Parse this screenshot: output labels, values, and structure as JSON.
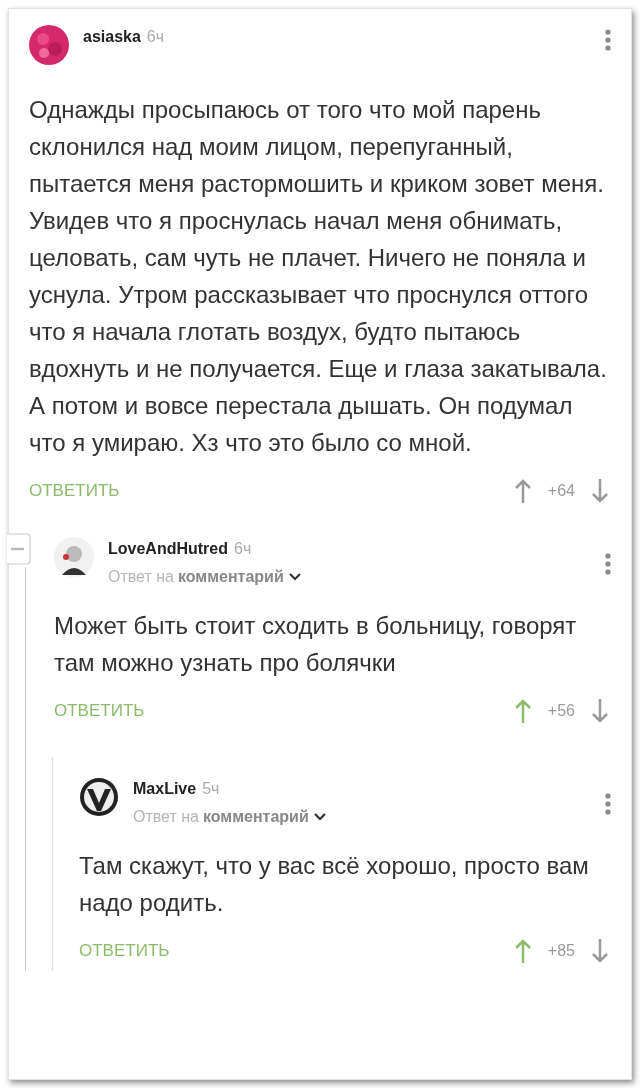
{
  "comments": [
    {
      "author": "asiaska",
      "time": "6ч",
      "text": "Однажды просыпаюсь от того что мой парень склонился над моим лицом, перепуганный, пытается меня растормошить и криком зовет меня. Увидев что я проснулась начал меня обнимать, целовать, сам чуть не плачет. Ничего не поняла и уснула. Утром рассказывает что проснулся оттого что я начала глотать воздух, будто пытаюсь вдохнуть и не получается. Еще и глаза закатывала. А потом и вовсе перестала дышать. Он подумал что я умираю. Хз что это было со мной.",
      "reply_label": "ОТВЕТИТЬ",
      "score": "+64",
      "upvoted": false,
      "children": [
        {
          "author": "LoveAndHutred",
          "time": "6ч",
          "reply_to": {
            "prefix": "Ответ на",
            "link": "комментарий"
          },
          "text": "Может быть стоит сходить в больницу, говорят там можно узнать про болячки",
          "reply_label": "ОТВЕТИТЬ",
          "score": "+56",
          "upvoted": true,
          "children": [
            {
              "author": "MaxLive",
              "time": "5ч",
              "reply_to": {
                "prefix": "Ответ на",
                "link": "комментарий"
              },
              "text": "Там скажут, что у вас всё хорошо, просто вам надо родить.",
              "reply_label": "ОТВЕТИТЬ",
              "score": "+85",
              "upvoted": true
            }
          ]
        }
      ]
    }
  ]
}
